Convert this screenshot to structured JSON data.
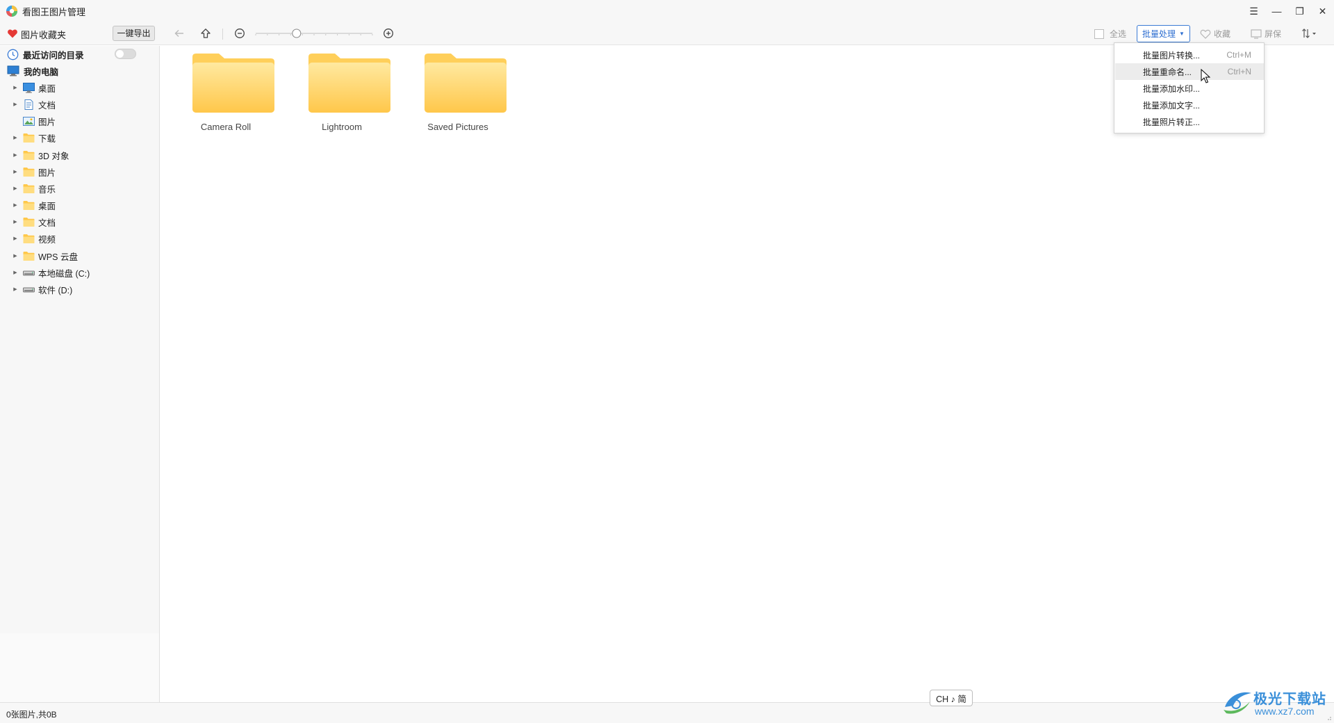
{
  "app": {
    "title": "看图王图片管理"
  },
  "window_controls": {
    "menu": "☰",
    "minimize": "—",
    "restore": "❐",
    "close": "✕"
  },
  "toolbar": {
    "favorites_label": "图片收藏夹",
    "export_label": "一键导出",
    "select_all_label": "全选",
    "batch_label": "批量处理",
    "collect_label": "收藏",
    "screensaver_label": "屏保",
    "zoom_level": 0.35,
    "icons": [
      "back-arrow-icon",
      "up-arrow-icon",
      "zoom-out-icon",
      "zoom-in-icon",
      "heart-icon",
      "sort-icon"
    ]
  },
  "sidebar": {
    "recent_label": "最近访问的目录",
    "recent_toggle_on": false,
    "computer_label": "我的电脑",
    "items": [
      {
        "label": "桌面",
        "icon": "desktop-icon",
        "expandable": true
      },
      {
        "label": "文档",
        "icon": "document-icon",
        "expandable": true
      },
      {
        "label": "图片",
        "icon": "picture-icon",
        "expandable": false
      },
      {
        "label": "下载",
        "icon": "folder-icon",
        "expandable": true
      },
      {
        "label": "3D 对象",
        "icon": "folder-icon",
        "expandable": true
      },
      {
        "label": "图片",
        "icon": "folder-icon",
        "expandable": true
      },
      {
        "label": "音乐",
        "icon": "folder-icon",
        "expandable": true
      },
      {
        "label": "桌面",
        "icon": "folder-icon",
        "expandable": true
      },
      {
        "label": "文档",
        "icon": "folder-icon",
        "expandable": true
      },
      {
        "label": "视频",
        "icon": "folder-icon",
        "expandable": true
      },
      {
        "label": "WPS 云盘",
        "icon": "folder-icon",
        "expandable": true
      },
      {
        "label": "本地磁盘 (C:)",
        "icon": "drive-icon",
        "expandable": true
      },
      {
        "label": "软件 (D:)",
        "icon": "drive-icon",
        "expandable": true
      }
    ]
  },
  "content": {
    "folders": [
      {
        "label": "Camera Roll"
      },
      {
        "label": "Lightroom"
      },
      {
        "label": "Saved Pictures"
      }
    ]
  },
  "batch_menu": {
    "items": [
      {
        "label": "批量图片转换...",
        "shortcut": "Ctrl+M"
      },
      {
        "label": "批量重命名...",
        "shortcut": "Ctrl+N"
      },
      {
        "label": "批量添加水印...",
        "shortcut": ""
      },
      {
        "label": "批量添加文字...",
        "shortcut": ""
      },
      {
        "label": "批量照片转正...",
        "shortcut": ""
      }
    ],
    "hovered_index": 1
  },
  "status": {
    "text": "0张图片,共0B"
  },
  "ime": {
    "text": "CH ♪ 简"
  },
  "watermark": {
    "name": "极光下载站",
    "url": "www.xz7.com"
  },
  "colors": {
    "accent": "#2f6fd1",
    "folder": "#ffd35e",
    "heart": "#e53935"
  }
}
